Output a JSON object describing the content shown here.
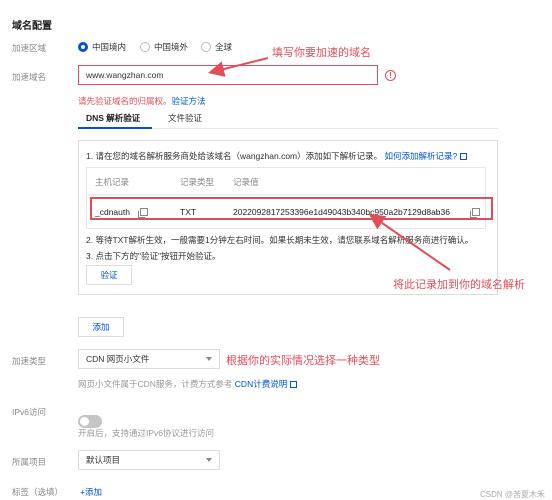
{
  "section_title": "域名配置",
  "region": {
    "label": "加速区域",
    "options": [
      {
        "label": "中国境内",
        "selected": true
      },
      {
        "label": "中国境外",
        "selected": false
      },
      {
        "label": "全球",
        "selected": false
      }
    ]
  },
  "domain": {
    "label": "加速域名",
    "value": "www.wangzhan.com",
    "error_text": "请先验证域名的归属权。",
    "verify_link": "验证方法"
  },
  "tabs": [
    {
      "label": "DNS 解析验证",
      "active": true
    },
    {
      "label": "文件验证",
      "active": false
    }
  ],
  "verify_panel": {
    "step1": "1. 请在您的域名解析服务商处给该域名（wangzhan.com）添加如下解析记录。",
    "step1_link": "如何添加解析记录?",
    "table": {
      "headers": [
        "主机记录",
        "记录类型",
        "记录值"
      ],
      "row": {
        "host": "_cdnauth",
        "type": "TXT",
        "value": "2022092817253396e1d49043b340bc950a2b7129d8ab36"
      }
    },
    "step2": "2. 等待TXT解析生效，一般需要1分钟左右时间。如果长期未生效，请您联系域名解析服务商进行确认。",
    "step3": "3. 点击下方的\"验证\"按钮开始验证。",
    "verify_button": "验证"
  },
  "add_button": "添加",
  "accel_type": {
    "label": "加速类型",
    "value": "CDN 网页小文件",
    "hint": "网页小文件属于CDN服务，计费方式参考",
    "hint_link": "CDN计费说明"
  },
  "ipv6": {
    "label": "IPv6访问",
    "enabled": false,
    "hint": "开启后，支持通过IPv6协议进行访问"
  },
  "project": {
    "label": "所属项目",
    "value": "默认项目"
  },
  "tags": {
    "label": "标签（选填）",
    "add_label": "+添加"
  },
  "annotations": {
    "domain_note": "填写你要加速的域名",
    "record_note": "将此记录加到你的域名解析",
    "type_note": "根据你的实际情况选择一种类型"
  },
  "watermark": "CSDN @苦夏木禾",
  "colors": {
    "accent": "#0052d9",
    "error": "#e34d59"
  }
}
